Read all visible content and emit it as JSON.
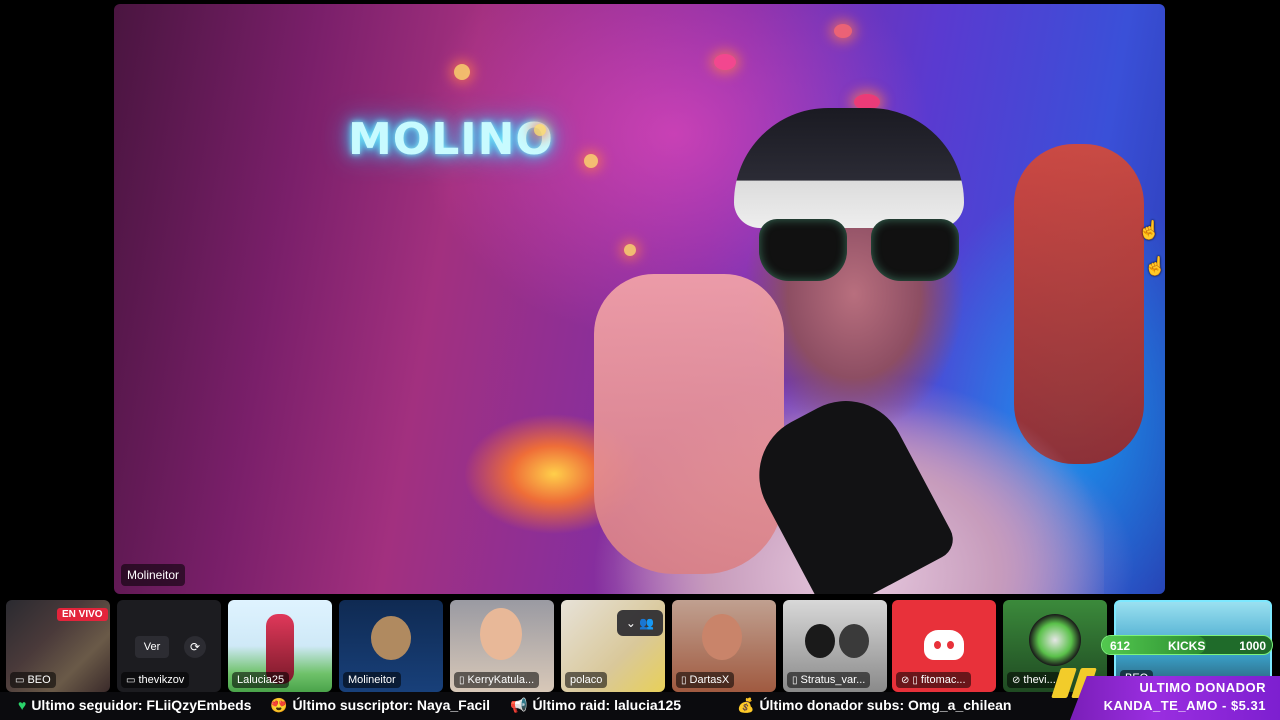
{
  "main_video": {
    "sign_text": "MOLINO",
    "name_tag": "Molineitor"
  },
  "thumbnails": [
    {
      "name": "BEO",
      "badge": "EN VIVO",
      "icon": "monitor-icon"
    },
    {
      "name": "thevikzov",
      "button_label": "Ver",
      "icon": "monitor-icon"
    },
    {
      "name": "Lalucia25"
    },
    {
      "name": "Molineitor"
    },
    {
      "name": "KerryKatula...",
      "icon": "phone-icon"
    },
    {
      "name": "polaco",
      "menu_icon": "chevron-down-icon",
      "people_icon": "add-people-icon"
    },
    {
      "name": "DartasX",
      "icon": "phone-icon"
    },
    {
      "name": "Stratus_var...",
      "icon": "phone-icon"
    },
    {
      "name": "fitomac...",
      "icon": "phone-icon",
      "muted_icon": "mic-off-icon"
    },
    {
      "name": "thevi...",
      "muted_icon": "mic-off-icon"
    },
    {
      "name": "BEO"
    }
  ],
  "kicks": {
    "current": "612",
    "label": "KICKS",
    "goal": "1000",
    "progress": 0.612
  },
  "ticker": {
    "follower": "Ultimo seguidor: FLiiQzyEmbeds",
    "subscriber": "Último suscriptor: Naya_Facil",
    "raid": "Último raid: lalucia125",
    "subs_donor": "Último donador subs: Omg_a_chilean"
  },
  "donor": {
    "title": "ULTIMO DONADOR",
    "value": "KANDA_TE_AMO - $5.31"
  },
  "colors": {
    "live_red": "#e3243b",
    "kicks_green": "#53c94f",
    "donor_purple": "#9a2ee0",
    "discord_red": "#e8313a"
  }
}
